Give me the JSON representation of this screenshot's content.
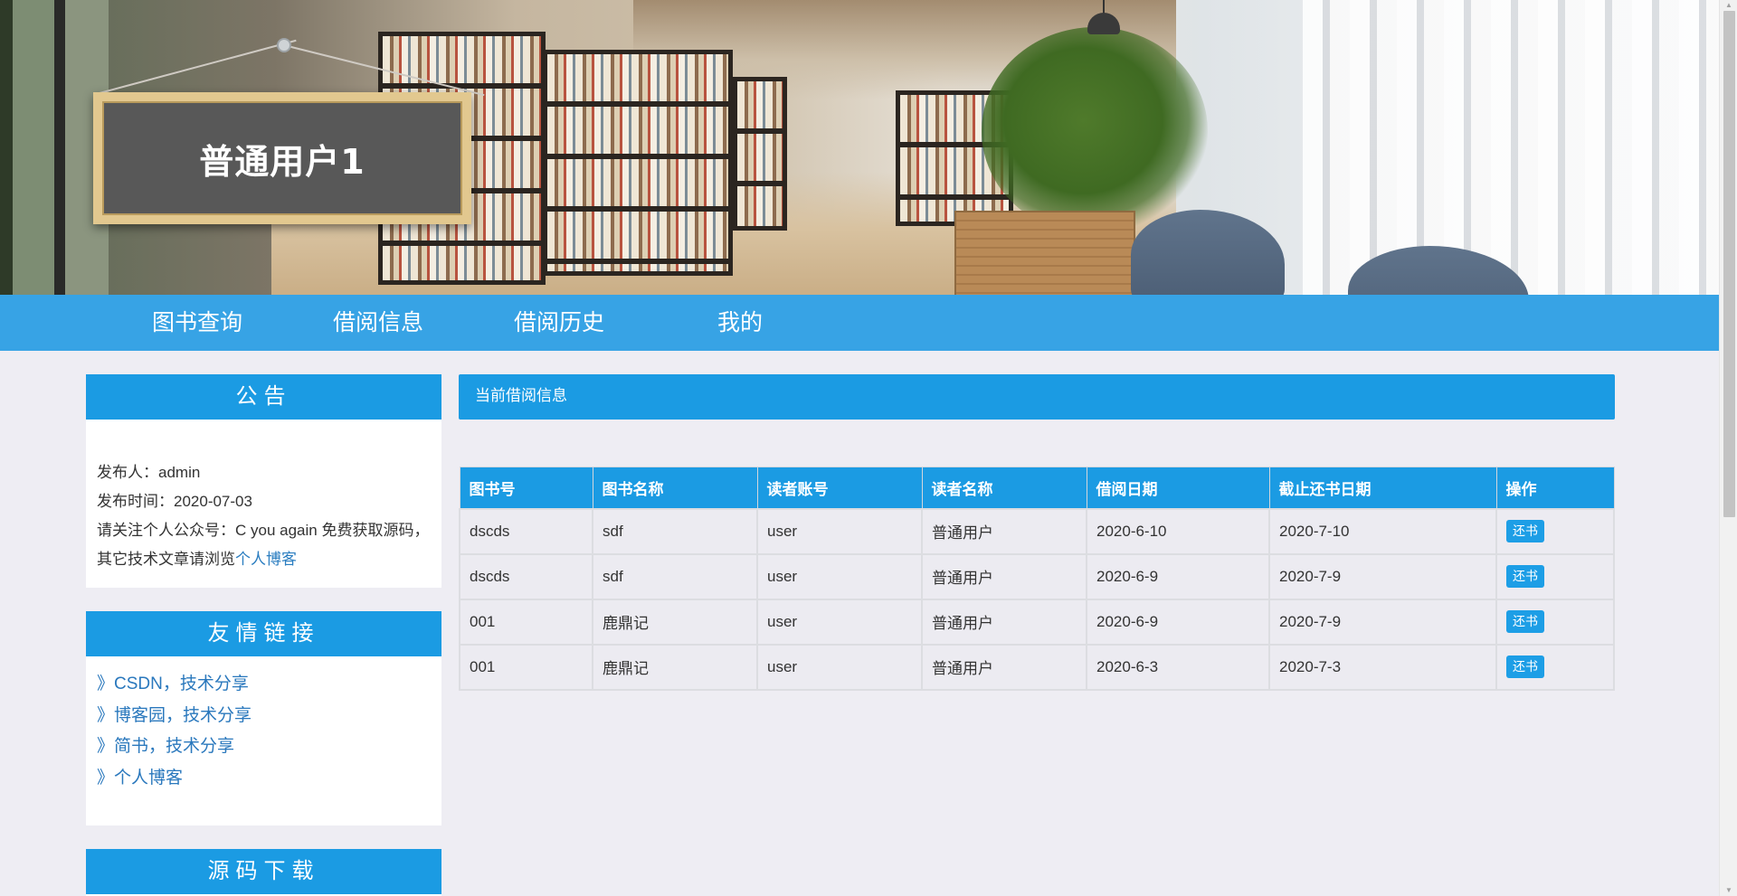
{
  "banner": {
    "sign_title": "普通用户1"
  },
  "nav": {
    "items": [
      {
        "label": "图书查询"
      },
      {
        "label": "借阅信息"
      },
      {
        "label": "借阅历史"
      },
      {
        "label": "我的"
      }
    ]
  },
  "sidebar": {
    "notice": {
      "title": "公告",
      "publisher": "发布人：admin",
      "publish_time": "发布时间：2020-07-03",
      "content_text": "请关注个人公众号：C you again 免费获取源码，其它技术文章请浏览",
      "content_link": "个人博客"
    },
    "links": {
      "title": "友情链接",
      "items": [
        {
          "label": "》CSDN，技术分享"
        },
        {
          "label": "》博客园，技术分享"
        },
        {
          "label": "》简书，技术分享"
        },
        {
          "label": "》个人博客"
        }
      ]
    },
    "download": {
      "title": "源码下载"
    }
  },
  "main": {
    "section_title": "当前借阅信息",
    "table": {
      "headers": [
        "图书号",
        "图书名称",
        "读者账号",
        "读者名称",
        "借阅日期",
        "截止还书日期",
        "操作"
      ],
      "action_label": "还书",
      "rows": [
        [
          "dscds",
          "sdf",
          "user",
          "普通用户",
          "2020-6-10",
          "2020-7-10"
        ],
        [
          "dscds",
          "sdf",
          "user",
          "普通用户",
          "2020-6-9",
          "2020-7-9"
        ],
        [
          "001",
          "鹿鼎记",
          "user",
          "普通用户",
          "2020-6-9",
          "2020-7-9"
        ],
        [
          "001",
          "鹿鼎记",
          "user",
          "普通用户",
          "2020-6-3",
          "2020-7-3"
        ]
      ]
    }
  },
  "colors": {
    "accent": "#1b9be3",
    "nav_bg": "#1896e2",
    "page_bg": "#eeedf3",
    "link": "#2a78bd"
  },
  "icons": {
    "scroll_up": "triangle-up",
    "scroll_down": "triangle-down"
  }
}
